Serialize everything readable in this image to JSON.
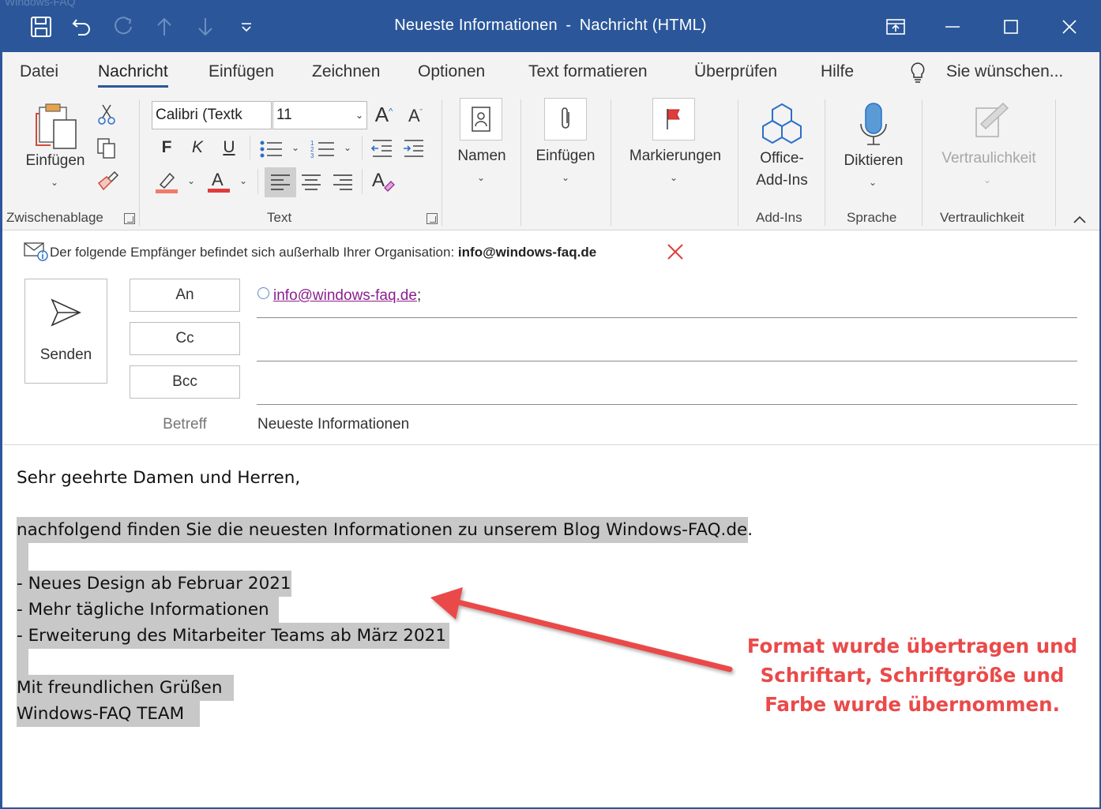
{
  "window": {
    "title": "Neueste Informationen",
    "title_suffix": "Nachricht (HTML)",
    "watermark": "Windows-FAQ"
  },
  "tabs": [
    "Datei",
    "Nachricht",
    "Einfügen",
    "Zeichnen",
    "Optionen",
    "Text formatieren",
    "Überprüfen",
    "Hilfe"
  ],
  "tell_me": "Sie wünschen...",
  "ribbon": {
    "clipboard": {
      "paste": "Einfügen",
      "group": "Zwischenablage"
    },
    "text": {
      "font": "Calibri (Textk",
      "size": "11",
      "bold": "F",
      "italic": "K",
      "underline": "U",
      "group": "Text"
    },
    "names": {
      "label": "Namen"
    },
    "insert": {
      "label": "Einfügen"
    },
    "tags": {
      "label": "Markierungen"
    },
    "addins": {
      "label1": "Office-",
      "label2": "Add-Ins",
      "group": "Add-Ins"
    },
    "voice": {
      "label": "Diktieren",
      "group": "Sprache"
    },
    "sensitivity": {
      "label": "Vertraulichkeit",
      "group": "Vertraulichkeit"
    }
  },
  "infobar": {
    "text": "Der folgende Empfänger befindet sich außerhalb Ihrer Organisation:",
    "email": "info@windows-faq.de"
  },
  "header": {
    "send": "Senden",
    "to_button": "An",
    "cc_button": "Cc",
    "bcc_button": "Bcc",
    "recipient": "info@windows-faq.de",
    "recipient_sep": ";",
    "subject_label": "Betreff",
    "subject": "Neueste Informationen"
  },
  "body": {
    "greeting": "Sehr geehrte Damen und Herren,",
    "intro": "nachfolgend finden Sie die neuesten Informationen zu unserem Blog Windows-FAQ.de.",
    "items": [
      "- Neues Design ab Februar 2021",
      "- Mehr tägliche Informationen",
      "- Erweiterung des Mitarbeiter Teams ab März 2021"
    ],
    "closing": "Mit freundlichen Grüßen",
    "signature": "Windows-FAQ TEAM"
  },
  "annotation": {
    "line1": "Format wurde übertragen und",
    "line2": "Schriftart, Schriftgröße und",
    "line3": "Farbe wurde übernommen."
  },
  "colors": {
    "titlebar": "#2b579a",
    "highlight": "#c8c8c8",
    "annotation": "#ea4a4a",
    "link": "#8b1f8e"
  }
}
